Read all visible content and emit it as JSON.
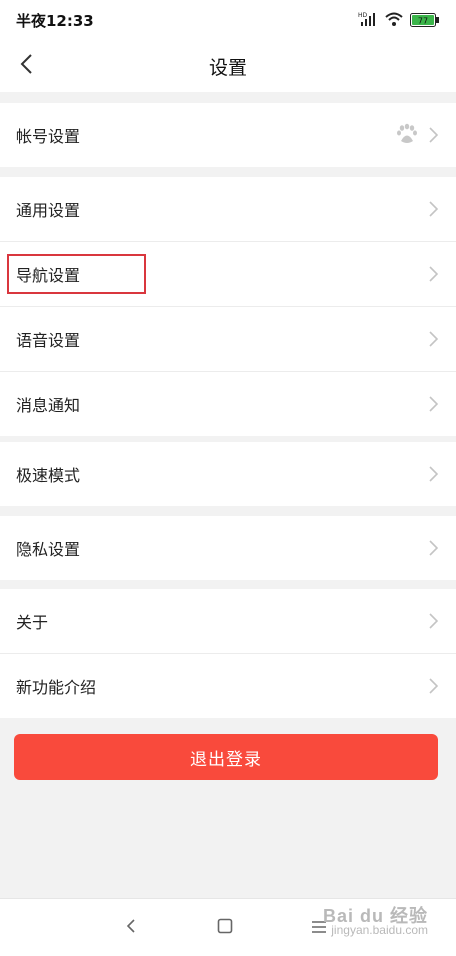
{
  "status_bar": {
    "time": "半夜12:33",
    "signal_label": "HD",
    "battery": "77"
  },
  "nav": {
    "title": "设置"
  },
  "groups": [
    {
      "items": [
        {
          "label": "帐号设置"
        }
      ]
    },
    {
      "items": [
        {
          "label": "通用设置"
        },
        {
          "label": "导航设置"
        },
        {
          "label": "语音设置"
        },
        {
          "label": "消息通知"
        }
      ]
    },
    {
      "items": [
        {
          "label": "极速模式"
        }
      ]
    },
    {
      "items": [
        {
          "label": "隐私设置"
        }
      ]
    },
    {
      "items": [
        {
          "label": "关于"
        },
        {
          "label": "新功能介绍"
        }
      ]
    }
  ],
  "logout": {
    "label": "退出登录"
  },
  "watermark": {
    "brand": "Bai du 经验",
    "url": "jingyan.baidu.com"
  },
  "colors": {
    "accent": "#f94a3c",
    "highlight": "#d9363e"
  }
}
